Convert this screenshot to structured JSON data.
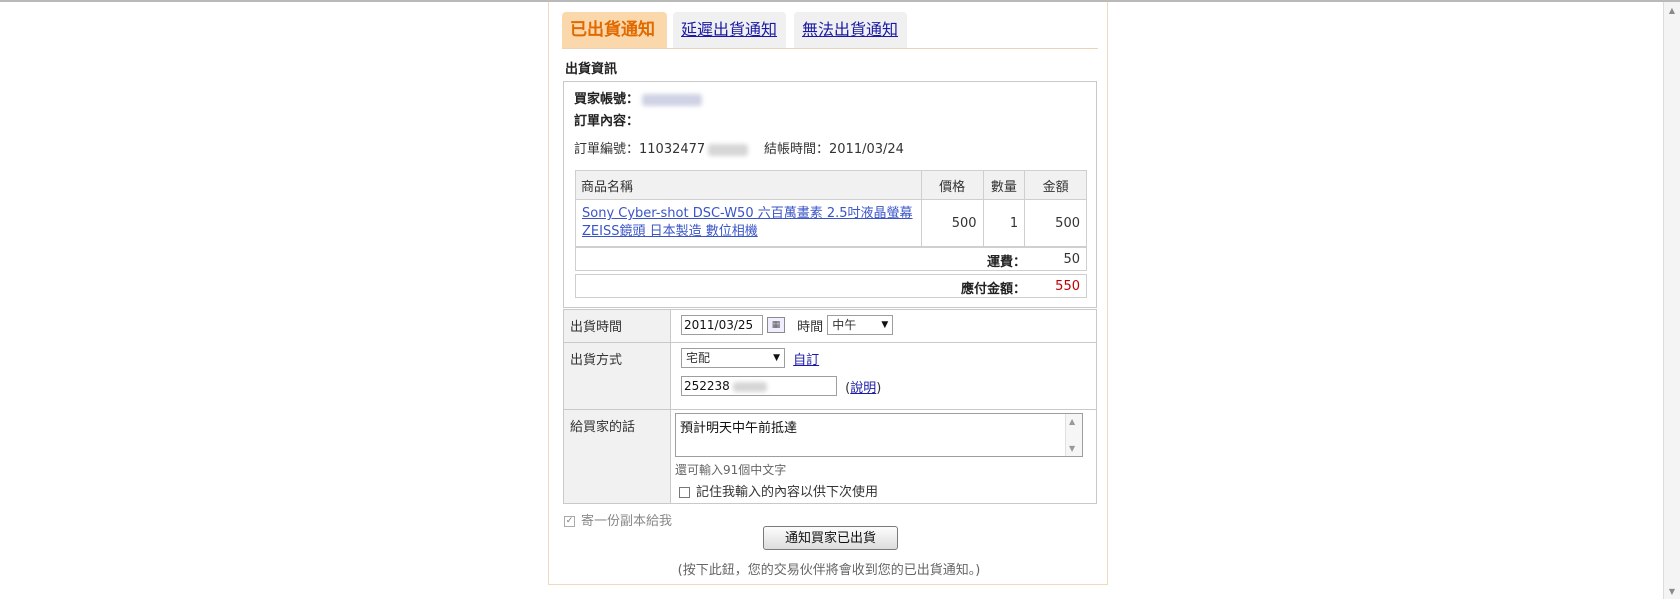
{
  "tabs": {
    "shipped": "已出貨通知",
    "delayed": "延遲出貨通知",
    "cannot": "無法出貨通知"
  },
  "section_title": "出貨資訊",
  "buyer": {
    "label": "買家帳號：",
    "value": ""
  },
  "order_content_label": "訂單內容：",
  "order": {
    "number_label": "訂單編號：",
    "number_value": "11032477",
    "checkout_label": "結帳時間：",
    "checkout_value": "2011/03/24"
  },
  "items_table": {
    "headers": [
      "商品名稱",
      "價格",
      "數量",
      "金額"
    ],
    "rows": [
      {
        "name": "Sony Cyber-shot DSC-W50 六百萬畫素 2.5吋液晶螢幕 ZEISS鏡頭 日本製造 數位相機",
        "price": "500",
        "qty": "1",
        "amount": "500"
      }
    ]
  },
  "shipping_fee": {
    "label": "運費：",
    "value": "50"
  },
  "total": {
    "label": "應付金額：",
    "value": "550"
  },
  "form": {
    "ship_time": {
      "label": "出貨時間",
      "date": "2011/03/25",
      "time_label": "時間",
      "time_value": "中午"
    },
    "ship_method": {
      "label": "出貨方式",
      "method": "宅配",
      "custom_link": "自訂",
      "tracking": "252238",
      "explain_link": "說明"
    },
    "message": {
      "label": "給買家的話",
      "text": "預計明天中午前抵達",
      "remaining": "還可輸入91個中文字",
      "remember": "記住我輸入的內容以供下次使用"
    }
  },
  "copy_to_me": "寄一份副本給我",
  "submit_label": "通知買家已出貨",
  "footer_note": "(按下此鈕，您的交易伙伴將會收到您的已出貨通知。)"
}
